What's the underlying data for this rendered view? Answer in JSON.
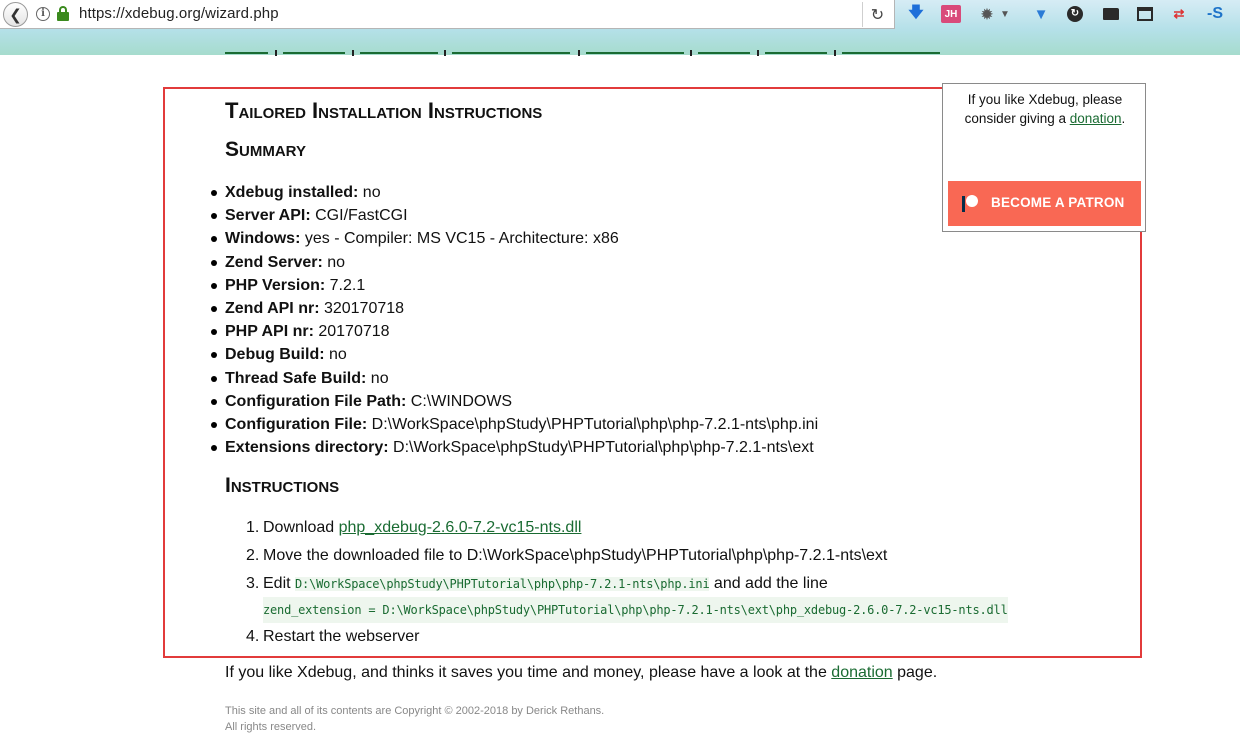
{
  "browser": {
    "url": "https://xdebug.org/wizard.php",
    "toolbar": {
      "jh_badge": "JH",
      "s_badge": "-S"
    }
  },
  "sidebar": {
    "text_before": "If you like Xdebug, please consider giving a ",
    "donation_link": "donation",
    "text_after": ".",
    "patron_button": "BECOME A PATRON",
    "patron_color": "#f96854"
  },
  "headings": {
    "title": "Tailored Installation Instructions",
    "summary": "Summary",
    "instructions": "Instructions"
  },
  "summary": [
    {
      "label": "Xdebug installed:",
      "value": " no"
    },
    {
      "label": "Server API:",
      "value": " CGI/FastCGI"
    },
    {
      "label": "Windows:",
      "value": " yes - Compiler: MS VC15 - Architecture: x86"
    },
    {
      "label": "Zend Server:",
      "value": " no"
    },
    {
      "label": "PHP Version:",
      "value": " 7.2.1"
    },
    {
      "label": "Zend API nr:",
      "value": " 320170718"
    },
    {
      "label": "PHP API nr:",
      "value": " 20170718"
    },
    {
      "label": "Debug Build:",
      "value": " no"
    },
    {
      "label": "Thread Safe Build:",
      "value": " no"
    },
    {
      "label": "Configuration File Path:",
      "value": " C:\\WINDOWS"
    },
    {
      "label": "Configuration File:",
      "value": " D:\\WorkSpace\\phpStudy\\PHPTutorial\\php\\php-7.2.1-nts\\php.ini"
    },
    {
      "label": "Extensions directory:",
      "value": " D:\\WorkSpace\\phpStudy\\PHPTutorial\\php\\php-7.2.1-nts\\ext"
    }
  ],
  "steps": {
    "s1_num": "1.",
    "s1_text": "Download ",
    "s1_link": "php_xdebug-2.6.0-7.2-vc15-nts.dll",
    "s2_num": "2.",
    "s2_text": "Move the downloaded file to D:\\WorkSpace\\phpStudy\\PHPTutorial\\php\\php-7.2.1-nts\\ext",
    "s3_num": "3.",
    "s3_text": "Edit ",
    "s3_code": "D:\\WorkSpace\\phpStudy\\PHPTutorial\\php\\php-7.2.1-nts\\php.ini",
    "s3_text2": " and add the line",
    "s3_code_line": "zend_extension = D:\\WorkSpace\\phpStudy\\PHPTutorial\\php\\php-7.2.1-nts\\ext\\php_xdebug-2.6.0-7.2-vc15-nts.dll",
    "s4_num": "4.",
    "s4_text": "Restart the webserver"
  },
  "footer": {
    "donation_text_before": "If you like Xdebug, and thinks it saves you time and money, please have a look at the ",
    "donation_link": "donation",
    "donation_text_after": " page.",
    "copyright_line1": "This site and all of its contents are Copyright © 2002-2018 by Derick Rethans.",
    "copyright_line2": "All rights reserved."
  },
  "colors": {
    "link": "#1a6b32",
    "highlight_border": "#e23b3b"
  }
}
